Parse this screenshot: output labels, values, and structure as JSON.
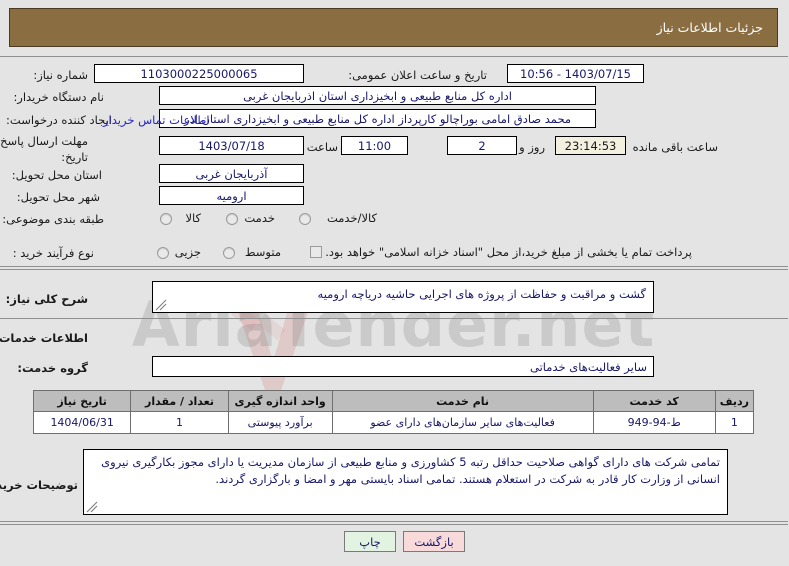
{
  "header": {
    "title": "جزئیات اطلاعات نیاز"
  },
  "form": {
    "need_number_label": "شماره نیاز:",
    "need_number_value": "1103000225000065",
    "announce_label": "تاریخ و ساعت اعلان عمومی:",
    "announce_value": "1403/07/15 - 10:56",
    "buyer_org_label": "نام دستگاه خریدار:",
    "buyer_org_value": "اداره کل منابع طبیعی و ابخیزداری استان اذربایجان غربی",
    "requester_label": "ایجاد کننده درخواست:",
    "requester_value": "محمد صادق امامی بوراچالو کارپرداز اداره کل منابع طبیعی و ابخیزداری استان اذر",
    "contact_link": "اطلاعات تماس خریدار",
    "deadline_label_line1": "مهلت ارسال پاسخ: تا",
    "deadline_label_line2": "تاریخ:",
    "deadline_date": "1403/07/18",
    "deadline_time_label": "ساعت",
    "deadline_time": "11:00",
    "remaining_days": "2",
    "remaining_days_label": "روز و",
    "remaining_clock": "23:14:53",
    "remaining_clock_label": "ساعت باقی مانده",
    "province_label": "استان محل تحویل:",
    "province_value": "آذربایجان غربی",
    "city_label": "شهر محل تحویل:",
    "city_value": "ارومیه",
    "category_label": "طبقه بندی موضوعی:",
    "category_options": [
      {
        "label": "کالا",
        "selected": false
      },
      {
        "label": "خدمت",
        "selected": false
      },
      {
        "label": "کالا/خدمت",
        "selected": false
      }
    ],
    "process_label": "نوع فرآیند خرید :",
    "process_options": [
      {
        "label": "جزیی",
        "selected": false
      },
      {
        "label": "متوسط",
        "selected": false
      }
    ],
    "treasury_checkbox_label": "پرداخت تمام یا بخشی از مبلغ خرید،از محل \"اسناد خزانه اسلامی\" خواهد بود.",
    "treasury_checked": false
  },
  "summary": {
    "label": "شرح کلی نیاز:",
    "value": "گشت و مراقبت و حفاظت از پروژه های اجرایی حاشیه دریاچه ارومیه"
  },
  "services_section": {
    "title": "اطلاعات خدمات مورد نیاز",
    "group_label": "گروه خدمت:",
    "group_value": "سایر فعالیت‌های خدماتی"
  },
  "table": {
    "columns": [
      "ردیف",
      "کد خدمت",
      "نام خدمت",
      "واحد اندازه گیری",
      "تعداد / مقدار",
      "تاریخ نیاز"
    ],
    "rows": [
      {
        "row": "1",
        "code": "ط-94-949",
        "name": "فعالیت‌های سایر سازمان‌های دارای عضو",
        "unit": "برآورد پیوستی",
        "quantity": "1",
        "date": "1404/06/31"
      }
    ]
  },
  "notes": {
    "label": "توضیحات خریدار:",
    "value": "تمامی شرکت های دارای گواهی صلاحیت حداقل رتبه 5 کشاورزی و منابع طبیعی از سازمان مدیریت یا دارای مجوز بکارگیری نیروی انسانی از وزارت کار قادر به شرکت در استعلام هستند. تمامی اسناد بایستی مهر و امضا و بارگزاری گردند."
  },
  "footer": {
    "print_label": "چاپ",
    "back_label": "بازگشت"
  },
  "watermark": {
    "text": "AriaTender.net"
  },
  "colors": {
    "header_bg": "#8b6d42",
    "link": "#2323c8",
    "value_text": "#17176b",
    "table_header_bg": "#bdbdbd",
    "print_btn_bg": "#e2f3e2",
    "back_btn_bg": "#f8dada"
  }
}
